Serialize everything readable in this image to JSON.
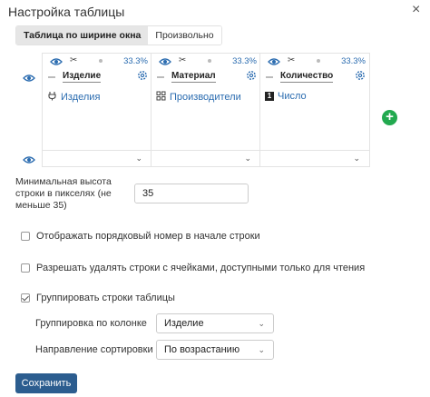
{
  "dialog": {
    "title": "Настройка таблицы",
    "close_glyph": "×"
  },
  "width_mode": {
    "options": [
      "Таблица по ширине окна",
      "Произвольно"
    ],
    "selected": 0
  },
  "columns": [
    {
      "name": "Изделие",
      "percent": "33.3%",
      "field_icon": "plug-icon",
      "field_label": "Изделия"
    },
    {
      "name": "Материал",
      "percent": "33.3%",
      "field_icon": "grid-icon",
      "field_label": "Производители"
    },
    {
      "name": "Количество",
      "percent": "33.3%",
      "field_icon": "number-icon",
      "field_label": "Число"
    }
  ],
  "icons": {
    "number_glyph": "1",
    "tools_glyph": "✂",
    "chevron": "⌄"
  },
  "add_button": {
    "glyph": "+",
    "color": "#22a94f"
  },
  "min_height": {
    "label": "Минимальная высота строки в пикселях (не меньше 35)",
    "value": "35"
  },
  "options": {
    "show_row_number": {
      "label": "Отображать порядковый номер в начале строки",
      "checked": false
    },
    "allow_delete_readonly": {
      "label": "Разрешать удалять строки с ячейками, доступными только для чтения",
      "checked": false
    },
    "group_rows": {
      "label": "Группировать строки таблицы",
      "checked": true
    }
  },
  "grouping": {
    "column_label": "Группировка по колонке",
    "column_value": "Изделие",
    "sort_label": "Направление сортировки",
    "sort_value": "По возрастанию"
  },
  "save_label": "Сохранить",
  "colors": {
    "accent": "#2c5d8f",
    "link": "#2b6cb0"
  }
}
